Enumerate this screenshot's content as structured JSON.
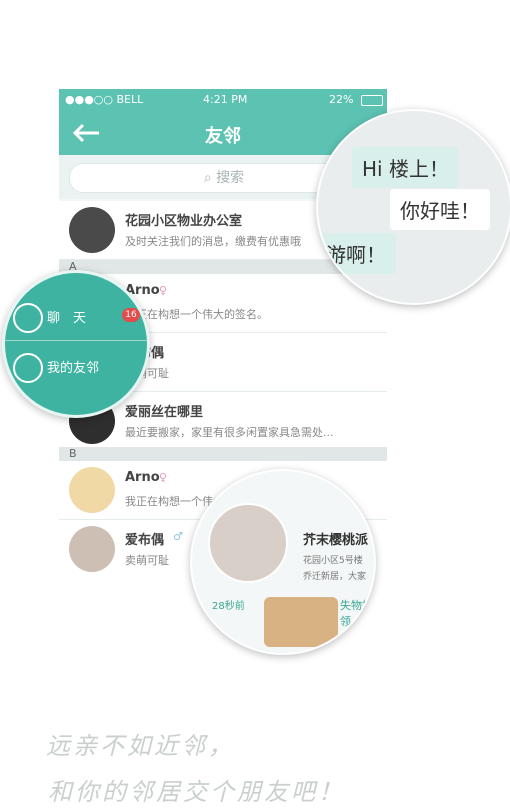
{
  "statusbar": {
    "carrier": "●●●○○ BELL",
    "time": "4:21 PM",
    "battery": "22%"
  },
  "nav": {
    "title": "友邻"
  },
  "search": {
    "placeholder": "搜索"
  },
  "contacts": {
    "office": {
      "name": "花园小区物业办公室",
      "desc": "及时关注我们的消息，缴费有优惠哦"
    },
    "section_a": "A",
    "r1": {
      "name": "Arno",
      "desc": "我正在构想一个伟大的签名。"
    },
    "r2": {
      "name": "爱布偶",
      "desc": "卖萌可耻"
    },
    "r3": {
      "name": "爱丽丝在哪里",
      "desc": "最近要搬家，家里有很多闲置家具急需处..."
    },
    "section_b": "B",
    "r4": {
      "name": "Arno",
      "desc": "我正在构想一个伟大的签名。"
    },
    "r5": {
      "name": "爱布偶",
      "desc": "卖萌可耻"
    }
  },
  "menu": {
    "chat": "聊　天",
    "badge": "16",
    "friends": "我的友邻"
  },
  "chat_bubbles": {
    "b1": "Hi 楼上！",
    "b2": "你好哇！",
    "b3": "游啊！"
  },
  "moment": {
    "title": "芥末樱桃派",
    "sub1": "花园小区5号楼",
    "sub2": "乔迁新居，大家",
    "time": "28秒前",
    "label": "失物招领"
  },
  "slogan": {
    "line1": "远亲不如近邻，",
    "line2": "和你的邻居交个朋友吧！"
  },
  "colors": {
    "accent": "#5cc2b2",
    "menu": "#3fb3a2",
    "badge": "#e64b4b"
  }
}
